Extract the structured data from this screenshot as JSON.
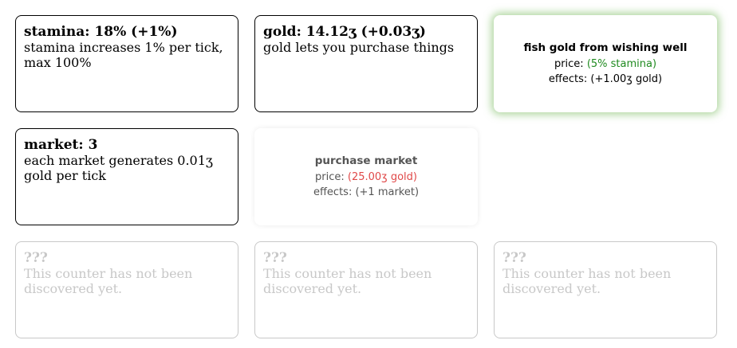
{
  "counters": {
    "stamina": {
      "title": "stamina: 18% (+1%)",
      "description": "stamina increases 1% per tick, max 100%"
    },
    "gold": {
      "title": "gold: 14.12ʒ (+0.03ʒ)",
      "description": "gold lets you purchase things"
    },
    "market": {
      "title": "market: 3",
      "description": "each market generates 0.01ʒ gold per tick"
    },
    "locked": [
      {
        "title": "???",
        "description": "This counter has not been discovered yet."
      },
      {
        "title": "???",
        "description": "This counter has not been discovered yet."
      },
      {
        "title": "???",
        "description": "This counter has not been discovered yet."
      }
    ]
  },
  "actions": {
    "fish": {
      "title": "fish gold from wishing well",
      "price_label": "price: ",
      "price_value": "(5% stamina)",
      "effects": "effects: (+1.00ʒ gold)",
      "affordable": true
    },
    "purchase_market": {
      "title": "purchase market",
      "price_label": "price: ",
      "price_value": "(25.00ʒ gold)",
      "effects": "effects: (+1 market)",
      "affordable": false
    }
  },
  "colors": {
    "affordable": "#1f8a1f",
    "unaffordable": "#e04848",
    "locked": "#c8c8c8",
    "glow": "#6eb450"
  }
}
